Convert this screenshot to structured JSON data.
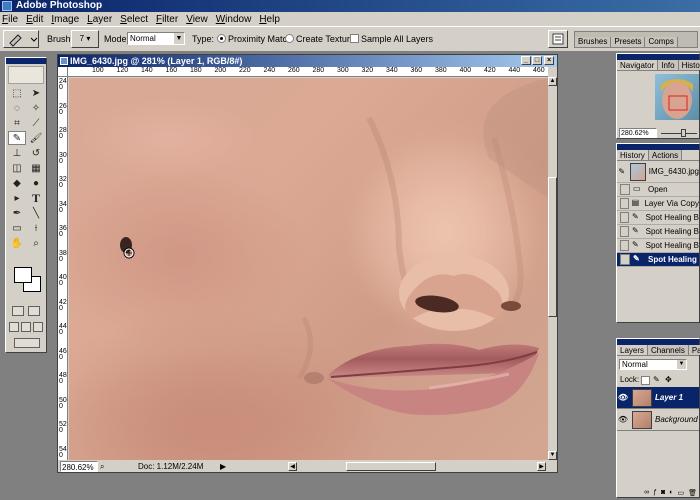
{
  "app": {
    "title": "Adobe Photoshop"
  },
  "menu": [
    "File",
    "Edit",
    "Image",
    "Layer",
    "Select",
    "Filter",
    "View",
    "Window",
    "Help"
  ],
  "options": {
    "brush_label": "Brush:",
    "brush_size": "7",
    "mode_label": "Mode:",
    "mode_value": "Normal",
    "type_label": "Type:",
    "type_proximity": "Proximity Match",
    "type_texture": "Create Texture",
    "sample_all": "Sample All Layers"
  },
  "palette_well": {
    "tabs": [
      "Brushes",
      "Presets",
      "Comps"
    ]
  },
  "document": {
    "title": "IMG_6430.jpg @ 281% (Layer 1, RGB/8#)",
    "zoom": "280.62%",
    "doc_size": "Doc: 1.12M/2.24M",
    "ruler_h": [
      "100",
      "120",
      "140",
      "160",
      "180",
      "200",
      "220",
      "240",
      "260",
      "280",
      "300",
      "320",
      "340",
      "360",
      "380",
      "400",
      "420",
      "440",
      "460",
      "480"
    ],
    "ruler_v": [
      "240",
      "260",
      "280",
      "300",
      "320",
      "340",
      "360",
      "380",
      "400",
      "420",
      "440",
      "460",
      "480",
      "500",
      "520",
      "540"
    ]
  },
  "navigator": {
    "tabs": [
      "Navigator",
      "Info",
      "Histogram"
    ],
    "zoom": "280.62%"
  },
  "history": {
    "tabs": [
      "History",
      "Actions"
    ],
    "snapshot": "IMG_6430.jpg",
    "items": [
      "Open",
      "Layer Via Copy",
      "Spot Healing B",
      "Spot Healing B",
      "Spot Healing B",
      "Spot Healing"
    ]
  },
  "layers": {
    "tabs": [
      "Layers",
      "Channels",
      "Paths"
    ],
    "blend_mode": "Normal",
    "lock_label": "Lock:",
    "items": [
      "Layer 1",
      "Background"
    ]
  },
  "icons": {
    "tools": [
      "marquee-icon",
      "move-icon",
      "lasso-icon",
      "magic-wand-icon",
      "crop-icon",
      "slice-icon",
      "spot-healing-icon",
      "brush-icon",
      "stamp-icon",
      "history-brush-icon",
      "eraser-icon",
      "gradient-icon",
      "blur-icon",
      "dodge-icon",
      "path-select-icon",
      "type-icon",
      "pen-icon",
      "line-icon",
      "notes-icon",
      "eyedropper-icon",
      "hand-icon",
      "zoom-icon"
    ]
  },
  "colors": {
    "title_bar": "#0a246a",
    "chrome": "#d4d0c8",
    "workspace": "#808080",
    "selection": "#0a246a"
  }
}
